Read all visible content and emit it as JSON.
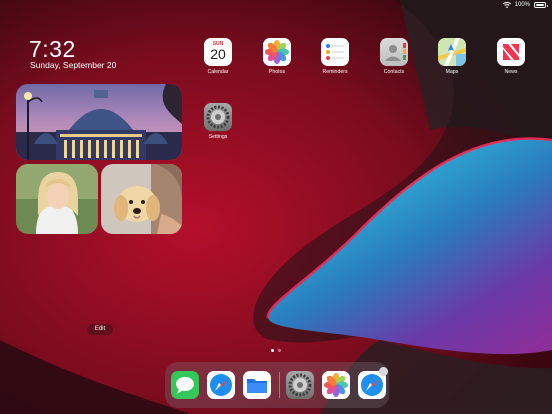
{
  "status_bar": {
    "battery": "100%",
    "battery_level": 1.0
  },
  "lock": {
    "time": "7:32",
    "date": "Sunday, September 20"
  },
  "calendar_icon": {
    "day": "SUN",
    "number": "20"
  },
  "apps": [
    {
      "label": "Calendar",
      "icon": "calendar-icon"
    },
    {
      "label": "Photos",
      "icon": "photos-icon"
    },
    {
      "label": "Reminders",
      "icon": "reminders-icon"
    },
    {
      "label": "Contacts",
      "icon": "contacts-icon"
    },
    {
      "label": "Maps",
      "icon": "maps-icon"
    },
    {
      "label": "News",
      "icon": "news-icon"
    },
    {
      "label": "Settings",
      "icon": "settings-icon"
    }
  ],
  "edit_button": {
    "label": "Edit"
  },
  "page_indicator": {
    "pages": 2,
    "current": 1
  },
  "dock": [
    {
      "icon": "messages-icon"
    },
    {
      "icon": "safari-icon"
    },
    {
      "icon": "files-icon"
    },
    {
      "icon": "settings-icon"
    },
    {
      "icon": "photos-icon"
    },
    {
      "icon": "safari-icon"
    }
  ],
  "colors": {
    "accent_red": "#c0102a",
    "wallpaper_dark": "#1a0a0d",
    "teal": "#2fc1d6",
    "purple": "#7a3fb0"
  }
}
